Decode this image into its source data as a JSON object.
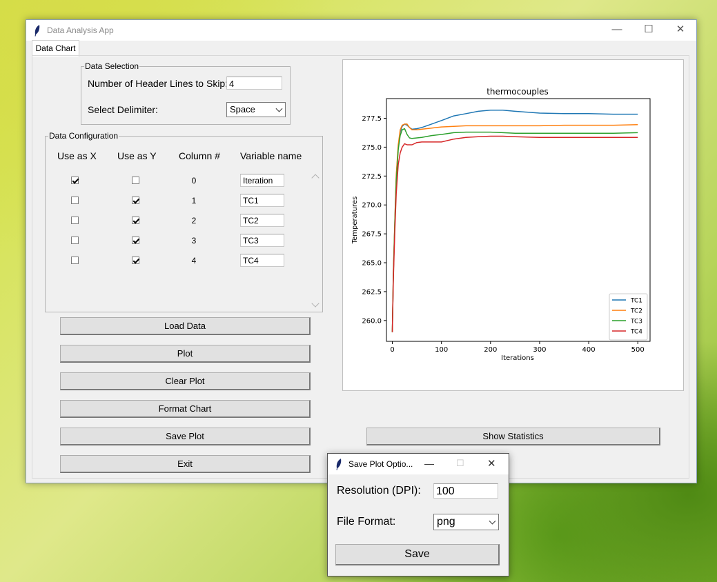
{
  "window": {
    "title": "Data Analysis App",
    "minimize": "—",
    "maximize": "☐",
    "close": "✕"
  },
  "tabs": [
    {
      "label": "Data Chart"
    }
  ],
  "data_selection": {
    "legend": "Data Selection",
    "header_lines_label": "Number of Header Lines to Skip:",
    "header_lines_value": "4",
    "delimiter_label": "Select Delimiter:",
    "delimiter_value": "Space"
  },
  "data_configuration": {
    "legend": "Data Configuration",
    "headers": {
      "use_x": "Use as X",
      "use_y": "Use as Y",
      "column": "Column #",
      "variable": "Variable name"
    },
    "rows": [
      {
        "use_x": true,
        "use_y": false,
        "column": "0",
        "name": "Iteration"
      },
      {
        "use_x": false,
        "use_y": true,
        "column": "1",
        "name": "TC1"
      },
      {
        "use_x": false,
        "use_y": true,
        "column": "2",
        "name": "TC2"
      },
      {
        "use_x": false,
        "use_y": true,
        "column": "3",
        "name": "TC3"
      },
      {
        "use_x": false,
        "use_y": true,
        "column": "4",
        "name": "TC4"
      }
    ]
  },
  "buttons": {
    "load_data": "Load Data",
    "plot": "Plot",
    "clear_plot": "Clear Plot",
    "format_chart": "Format Chart",
    "save_plot": "Save Plot",
    "exit": "Exit",
    "show_statistics": "Show Statistics"
  },
  "chart_data": {
    "type": "line",
    "title": "thermocouples",
    "xlabel": "Iterations",
    "ylabel": "Temperatures",
    "xlim": [
      -12,
      525
    ],
    "ylim": [
      258.2,
      279.2
    ],
    "xticks": [
      0,
      100,
      200,
      300,
      400,
      500
    ],
    "xtick_labels": [
      "0",
      "100",
      "200",
      "300",
      "400",
      "500"
    ],
    "yticks": [
      260,
      262.5,
      265,
      267.5,
      270,
      272.5,
      275,
      277.5
    ],
    "ytick_labels": [
      "260.0",
      "262.5",
      "265.0",
      "267.5",
      "270.0",
      "272.5",
      "275.0",
      "277.5"
    ],
    "legend_position": "lower-right",
    "x": [
      0,
      2,
      5,
      8,
      12,
      16,
      20,
      25,
      30,
      35,
      40,
      50,
      60,
      80,
      100,
      125,
      150,
      175,
      200,
      225,
      250,
      300,
      350,
      400,
      450,
      500
    ],
    "series": [
      {
        "name": "TC1",
        "color": "#1f77b4",
        "values": [
          259.0,
          264.0,
          268.5,
          272.5,
          275.0,
          276.3,
          276.8,
          277.0,
          276.9,
          276.7,
          276.55,
          276.6,
          276.7,
          277.0,
          277.3,
          277.7,
          277.9,
          278.1,
          278.2,
          278.2,
          278.1,
          277.95,
          277.9,
          277.9,
          277.85,
          277.85
        ]
      },
      {
        "name": "TC2",
        "color": "#ff7f0e",
        "values": [
          259.0,
          264.2,
          268.6,
          272.6,
          275.2,
          276.5,
          276.9,
          277.0,
          277.0,
          276.7,
          276.5,
          276.5,
          276.55,
          276.65,
          276.75,
          276.8,
          276.85,
          276.85,
          276.85,
          276.85,
          276.85,
          276.85,
          276.9,
          276.9,
          276.9,
          276.95
        ]
      },
      {
        "name": "TC3",
        "color": "#2ca02c",
        "values": [
          259.0,
          264.0,
          268.3,
          272.0,
          274.8,
          276.0,
          276.5,
          276.6,
          276.1,
          275.8,
          275.75,
          275.8,
          275.85,
          276.0,
          276.1,
          276.25,
          276.3,
          276.3,
          276.3,
          276.25,
          276.2,
          276.2,
          276.2,
          276.2,
          276.2,
          276.25
        ]
      },
      {
        "name": "TC4",
        "color": "#d62728",
        "values": [
          259.0,
          263.5,
          267.7,
          271.0,
          273.5,
          274.5,
          275.0,
          275.3,
          275.2,
          275.2,
          275.2,
          275.4,
          275.45,
          275.45,
          275.45,
          275.7,
          275.85,
          275.9,
          275.95,
          275.95,
          275.9,
          275.85,
          275.85,
          275.85,
          275.85,
          275.85
        ]
      }
    ]
  },
  "save_dialog": {
    "title": "Save Plot Optio...",
    "dpi_label": "Resolution (DPI):",
    "dpi_value": "100",
    "format_label": "File Format:",
    "format_value": "png",
    "save_button": "Save",
    "minimize": "—",
    "maximize": "☐",
    "close": "✕"
  }
}
